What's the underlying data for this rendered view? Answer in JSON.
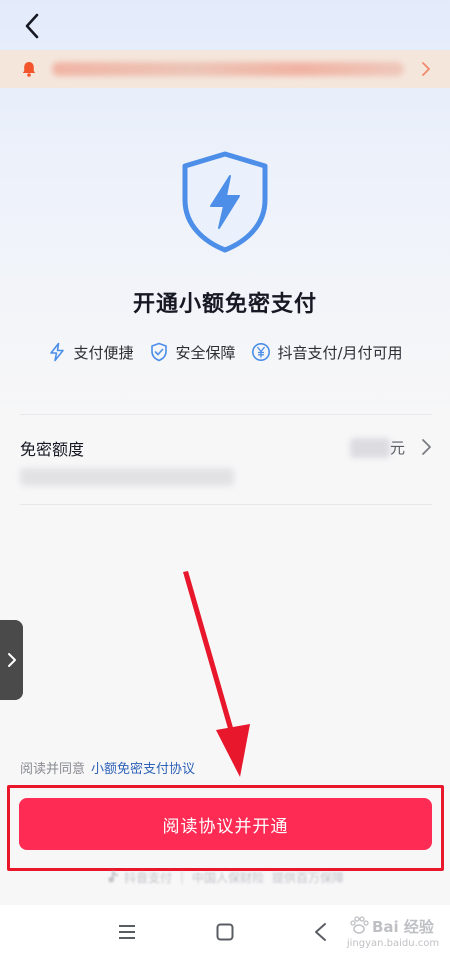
{
  "header": {
    "back_icon": "chevron-left-icon"
  },
  "notice": {
    "icon": "bell-icon",
    "arrow_icon": "chevron-right-icon"
  },
  "hero": {
    "icon": "shield-lightning-icon",
    "title": "开通小额免密支付"
  },
  "features": [
    {
      "icon": "lightning-icon",
      "label": "支付便捷"
    },
    {
      "icon": "shield-check-icon",
      "label": "安全保障"
    },
    {
      "icon": "yuan-circle-icon",
      "label": "抖音支付/月付可用"
    }
  ],
  "limit": {
    "label": "免密额度",
    "unit": "元",
    "chevron_icon": "chevron-right-icon"
  },
  "agreement": {
    "prefix": "阅读并同意",
    "link": "小额免密支付协议"
  },
  "primary_button": {
    "label": "阅读协议并开通"
  },
  "footer": {
    "brand1": "抖音支付",
    "separator": "|",
    "brand2": "中国人保财险",
    "brand3": "提供百万保障"
  },
  "system_nav": {
    "menu_icon": "menu-icon",
    "home_icon": "square-home-icon",
    "back_icon": "triangle-back-icon"
  },
  "watermark": {
    "text": "Bai 经验",
    "sub": "jingyan.baidu.com"
  },
  "colors": {
    "accent": "#fe2c55",
    "link": "#2f63b8",
    "shield": "#4d8fe8",
    "annotation": "#e8172b"
  }
}
